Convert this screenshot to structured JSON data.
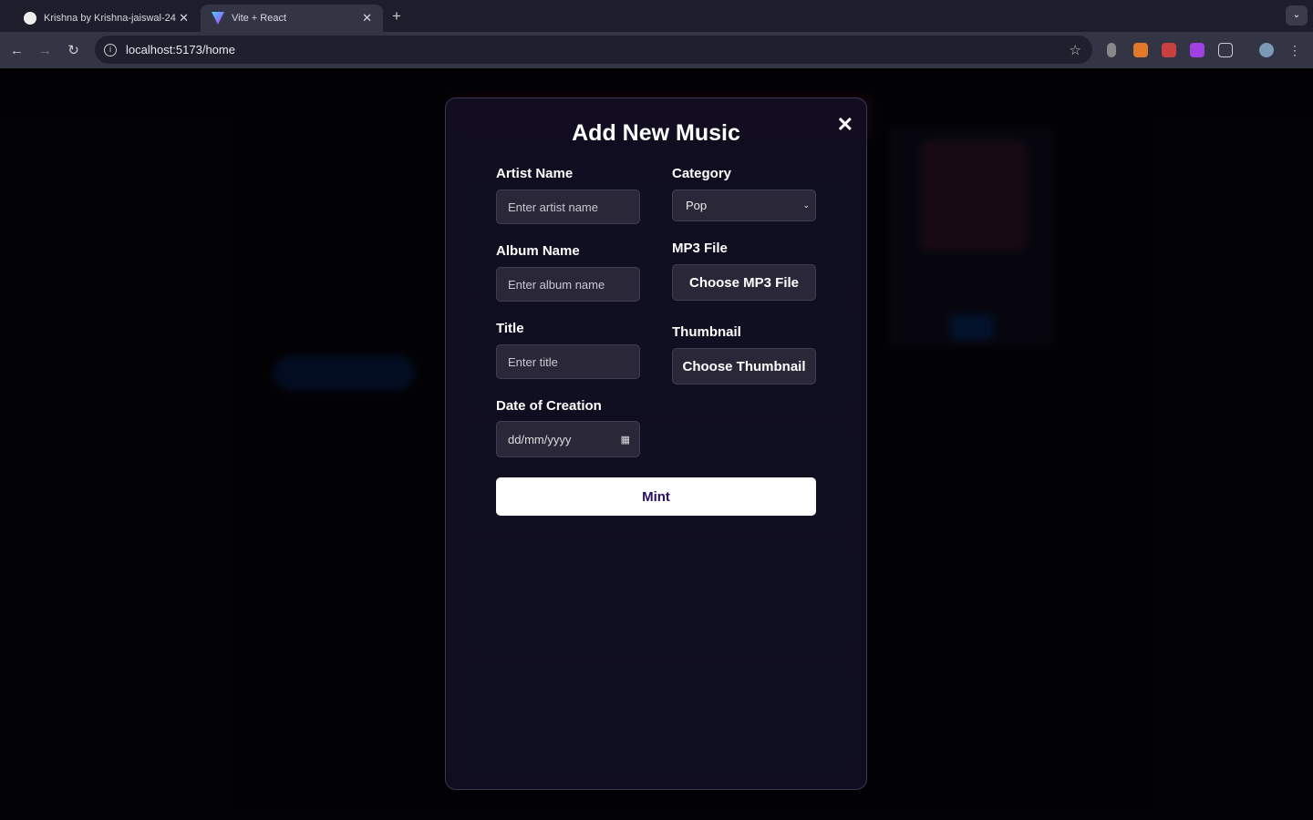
{
  "browser": {
    "tabs": [
      {
        "label": "Krishna by Krishna-jaiswal-24",
        "icon": "github-icon"
      },
      {
        "label": "Vite + React",
        "icon": "vite-icon",
        "active": true
      }
    ],
    "url": "localhost:5173/home"
  },
  "modal": {
    "title": "Add New Music",
    "fields": {
      "artist": {
        "label": "Artist Name",
        "placeholder": "Enter artist name",
        "value": ""
      },
      "album": {
        "label": "Album Name",
        "placeholder": "Enter album name",
        "value": ""
      },
      "title": {
        "label": "Title",
        "placeholder": "Enter title",
        "value": ""
      },
      "date": {
        "label": "Date of Creation",
        "placeholder": "dd/mm/yyyy"
      },
      "category": {
        "label": "Category",
        "value": "Pop"
      },
      "mp3": {
        "label": "MP3 File",
        "button": "Choose MP3 File"
      },
      "thumbnail": {
        "label": "Thumbnail",
        "button": "Choose Thumbnail"
      }
    },
    "submit": "Mint"
  }
}
